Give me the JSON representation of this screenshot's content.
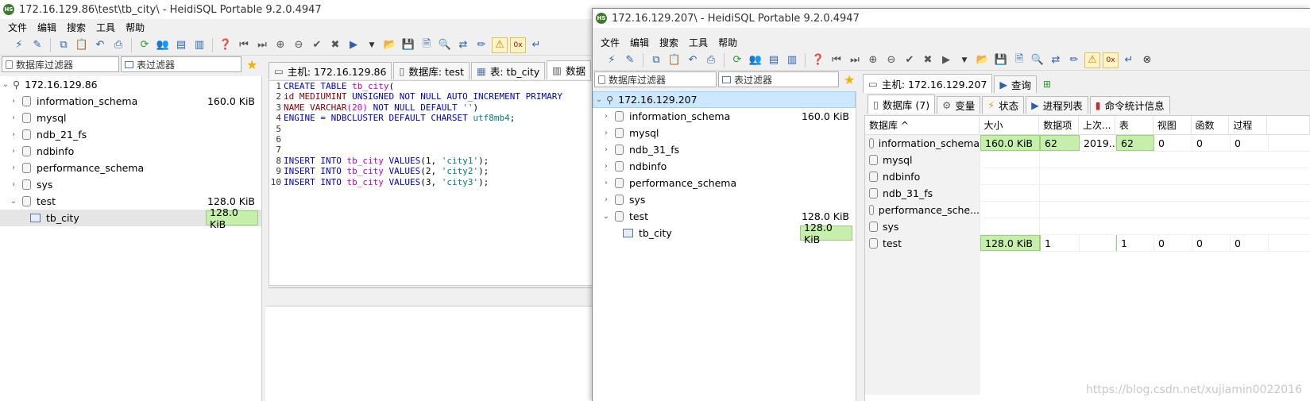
{
  "winA": {
    "title": "172.16.129.86\\test\\tb_city\\ - HeidiSQL Portable 9.2.0.4947",
    "menu": [
      "文件",
      "编辑",
      "搜索",
      "工具",
      "帮助"
    ],
    "db_filter": "数据库过滤器",
    "table_filter": "表过滤器",
    "tree": {
      "host": "172.16.129.86",
      "dbs": [
        {
          "name": "information_schema",
          "size": "160.0 KiB"
        },
        {
          "name": "mysql",
          "size": ""
        },
        {
          "name": "ndb_21_fs",
          "size": ""
        },
        {
          "name": "ndbinfo",
          "size": ""
        },
        {
          "name": "performance_schema",
          "size": ""
        },
        {
          "name": "sys",
          "size": ""
        },
        {
          "name": "test",
          "size": "128.0 KiB"
        }
      ],
      "table": {
        "name": "tb_city",
        "size": "128.0 KiB"
      }
    },
    "tabs": [
      "主机: 172.16.129.86",
      "数据库: test",
      "表: tb_city",
      "数据"
    ],
    "code": {
      "l1a": "CREATE TABLE ",
      "l1b": "tb_city",
      "l1c": "(",
      "l2a": "id ",
      "l2b": "MEDIUMINT",
      "l2c": " UNSIGNED NOT NULL AUTO_INCREMENT PRIMARY",
      "l3a": "NAME ",
      "l3b": "VARCHAR",
      "l3c": "(20)",
      "l3d": " NOT NULL DEFAULT ",
      "l3e": "''",
      "l3f": ")",
      "l4a": "ENGINE = NDBCLUSTER DEFAULT CHARSET ",
      "l4b": "utf8mb4",
      "l4c": ";",
      "ins": "INSERT INTO ",
      "tbl": "tb_city",
      "vals": " VALUES",
      "l8v": "(1, ",
      "l8s": "'city1'",
      "l9v": "(2, ",
      "l9s": "'city2'",
      "l10v": "(3, ",
      "l10s": "'city3'",
      "end": ");"
    }
  },
  "winB": {
    "title": "172.16.129.207\\ - HeidiSQL Portable 9.2.0.4947",
    "menu": [
      "文件",
      "编辑",
      "搜索",
      "工具",
      "帮助"
    ],
    "db_filter": "数据库过滤器",
    "table_filter": "表过滤器",
    "tree": {
      "host": "172.16.129.207",
      "dbs": [
        {
          "name": "information_schema",
          "size": "160.0 KiB"
        },
        {
          "name": "mysql",
          "size": ""
        },
        {
          "name": "ndb_31_fs",
          "size": ""
        },
        {
          "name": "ndbinfo",
          "size": ""
        },
        {
          "name": "performance_schema",
          "size": ""
        },
        {
          "name": "sys",
          "size": ""
        },
        {
          "name": "test",
          "size": "128.0 KiB"
        }
      ],
      "table": {
        "name": "tb_city",
        "size": "128.0 KiB"
      }
    },
    "top_tabs": [
      "主机: 172.16.129.207",
      "查询"
    ],
    "sub_tabs": [
      "数据库 (7)",
      "变量",
      "状态",
      "进程列表",
      "命令统计信息"
    ],
    "grid": {
      "headers": [
        "数据库 ^",
        "大小",
        "数据项",
        "上次...",
        "表",
        "视图",
        "函数",
        "过程"
      ],
      "rows": [
        [
          "information_schema",
          "160.0 KiB",
          "62",
          "2019...",
          "62",
          "0",
          "0",
          "0"
        ],
        [
          "mysql",
          "",
          "",
          "",
          "",
          "",
          "",
          ""
        ],
        [
          "ndbinfo",
          "",
          "",
          "",
          "",
          "",
          "",
          ""
        ],
        [
          "ndb_31_fs",
          "",
          "",
          "",
          "",
          "",
          "",
          ""
        ],
        [
          "performance_sche...",
          "",
          "",
          "",
          "",
          "",
          "",
          ""
        ],
        [
          "sys",
          "",
          "",
          "",
          "",
          "",
          "",
          ""
        ],
        [
          "test",
          "128.0 KiB",
          "1",
          "",
          "1",
          "0",
          "0",
          "0"
        ]
      ]
    }
  },
  "watermark": "https://blog.csdn.net/xujiamin0022016",
  "colors": {
    "selection": "#cce8ff",
    "size_bar": "#c6efac",
    "keyword": "#0000d0"
  }
}
